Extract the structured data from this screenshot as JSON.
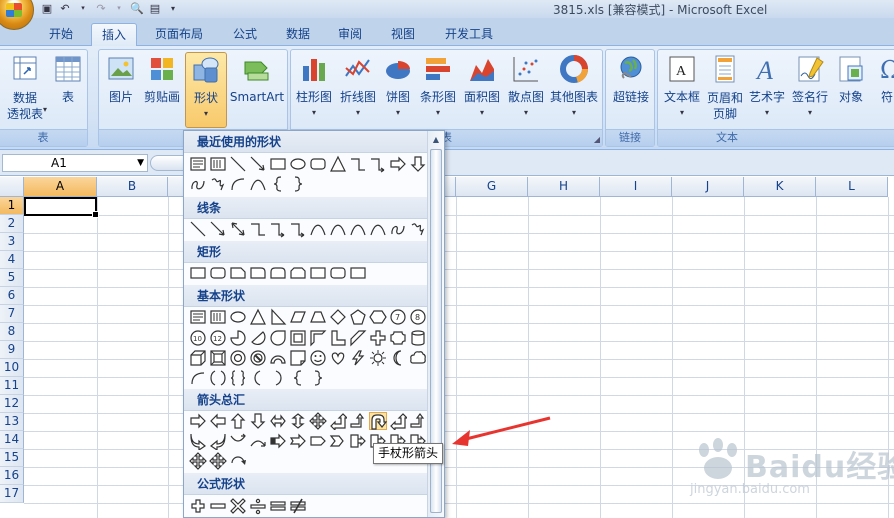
{
  "title": "3815.xls  [兼容模式] - Microsoft Excel",
  "tabs": [
    "开始",
    "插入",
    "页面布局",
    "公式",
    "数据",
    "审阅",
    "视图",
    "开发工具"
  ],
  "ribbon": {
    "pivot_label": "数据\n透视表",
    "table": "表",
    "picture": "图片",
    "clipart": "剪贴画",
    "shapes": "形状",
    "smartart": "SmartArt",
    "column": "柱形图",
    "line": "折线图",
    "pie": "饼图",
    "bar": "条形图",
    "area": "面积图",
    "scatter": "散点图",
    "other": "其他图表",
    "hyperlink": "超链接",
    "textbox": "文本框",
    "header_footer": "页眉和\n页脚",
    "wordart": "艺术字",
    "signature": "签名行",
    "object": "对象",
    "symbol": "符",
    "groups": {
      "tables": "表",
      "illustrations": "插",
      "charts": "表",
      "links": "链接",
      "text": "文本"
    }
  },
  "namebox": "A1",
  "columns": [
    "A",
    "B",
    "C",
    "D",
    "E",
    "F",
    "G",
    "H",
    "I",
    "J",
    "K",
    "L"
  ],
  "rows": [
    "1",
    "2",
    "3",
    "4",
    "5",
    "6",
    "7",
    "8",
    "9",
    "10",
    "11",
    "12",
    "13",
    "14",
    "15",
    "16",
    "17"
  ],
  "gallery": {
    "sections": [
      "最近使用的形状",
      "线条",
      "矩形",
      "基本形状",
      "箭头总汇",
      "公式形状"
    ]
  },
  "tooltip": "手杖形箭头",
  "watermark": {
    "brand": "Baidu经验",
    "url": "jingyan.baidu.com"
  },
  "colors": {
    "accent": "#15428b",
    "selected": "#f8c96b",
    "annotation_arrow": "#e8342e"
  }
}
